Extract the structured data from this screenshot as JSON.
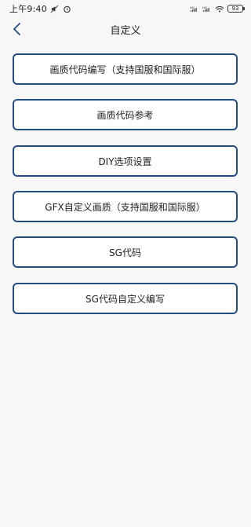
{
  "status_bar": {
    "time": "上午9:40",
    "battery": "93",
    "signal_text": "HD"
  },
  "header": {
    "title": "自定义"
  },
  "menu": {
    "items": [
      {
        "label": "画质代码编写（支持国服和国际服）"
      },
      {
        "label": "画质代码参考"
      },
      {
        "label": "DIY选项设置"
      },
      {
        "label": "GFX自定义画质（支持国服和国际服）"
      },
      {
        "label": "SG代码"
      },
      {
        "label": "SG代码自定义编写"
      }
    ]
  },
  "colors": {
    "accent": "#244d84",
    "page_bg": "#f7f7f7",
    "button_bg": "#ffffff"
  },
  "icons": {
    "back": "chevron-left-icon",
    "alarm": "alarm-icon",
    "wifi": "wifi-icon",
    "signal": "signal-icon",
    "battery": "battery-icon"
  }
}
